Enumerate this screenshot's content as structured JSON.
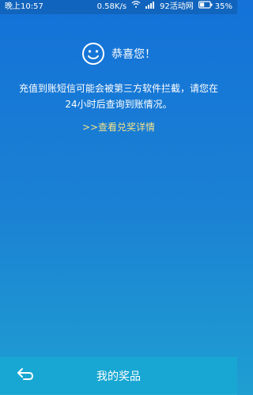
{
  "status_bar": {
    "time": "晚上10:57",
    "network_speed": "0.58K/s",
    "carrier": "92活动网",
    "battery_percent": "35%",
    "icons": {
      "wifi": "wifi-icon",
      "signal": "signal-icon",
      "battery": "battery-icon"
    }
  },
  "result": {
    "title": "恭喜您！",
    "icon": "smile-icon",
    "message_line1": "充值到账短信可能会被第三方软件拦截，请您在",
    "message_line2": "24小时后查询到账情况。",
    "link_label": ">>查看兑奖详情",
    "link_color": "#f0e28a"
  },
  "bottom_bar": {
    "back_icon": "back-arrow-icon",
    "title": "我的奖品"
  },
  "colors": {
    "gradient_top": "#1472d8",
    "gradient_bottom": "#1f9fd2",
    "bottom_bar": "#18a7d2"
  }
}
